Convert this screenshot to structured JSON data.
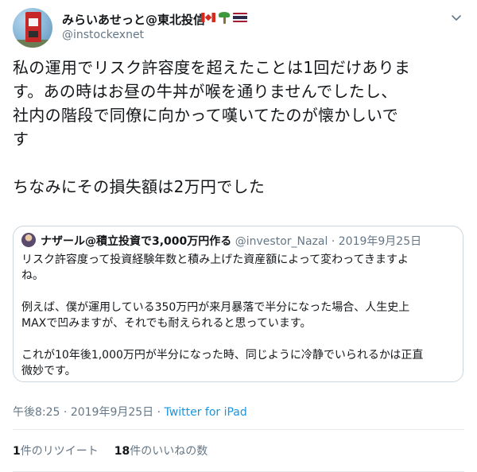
{
  "author": {
    "display_name": "みらいあせっと@東北投信",
    "handle": "@instockexnet",
    "name_icons": [
      "canada-flag-icon",
      "palm-tree-icon",
      "thailand-flag-icon"
    ]
  },
  "tweet": {
    "text": "私の運用でリスク許容度を超えたことは1回だけありま\nす。あの時はお昼の牛丼が喉を通りませんでしたし、\n社内の階段で同僚に向かって嘆いてたのが懐かしいで\nす\n\nちなみにその損失額は2万円でした"
  },
  "quoted_tweet": {
    "display_name": "ナザール@積立投資で3,000万円作る",
    "handle": "@investor_Nazal",
    "separator": "·",
    "date": "2019年9月25日",
    "text": "リスク許容度って投資経験年数と積み上げた資産額によって変わってきますよ\nね。\n\n例えば、僕が運用している350万円が来月暴落で半分になった場合、人生史上\nMAXで凹みますが、それでも耐えられると思っています。\n\nこれが10年後1,000万円が半分になった時、同じように冷静でいられるかは正直\n微妙です。"
  },
  "meta": {
    "time": "午後8:25",
    "separator": "·",
    "date": "2019年9月25日",
    "source": "Twitter for iPad"
  },
  "stats": {
    "retweet_count": "1",
    "retweet_label": "件のリツイート",
    "like_count": "18",
    "like_label": "件のいいねの数"
  },
  "colors": {
    "text": "#14171a",
    "secondary": "#657786",
    "link": "#1b95e0",
    "border": "#ccd6dd"
  }
}
